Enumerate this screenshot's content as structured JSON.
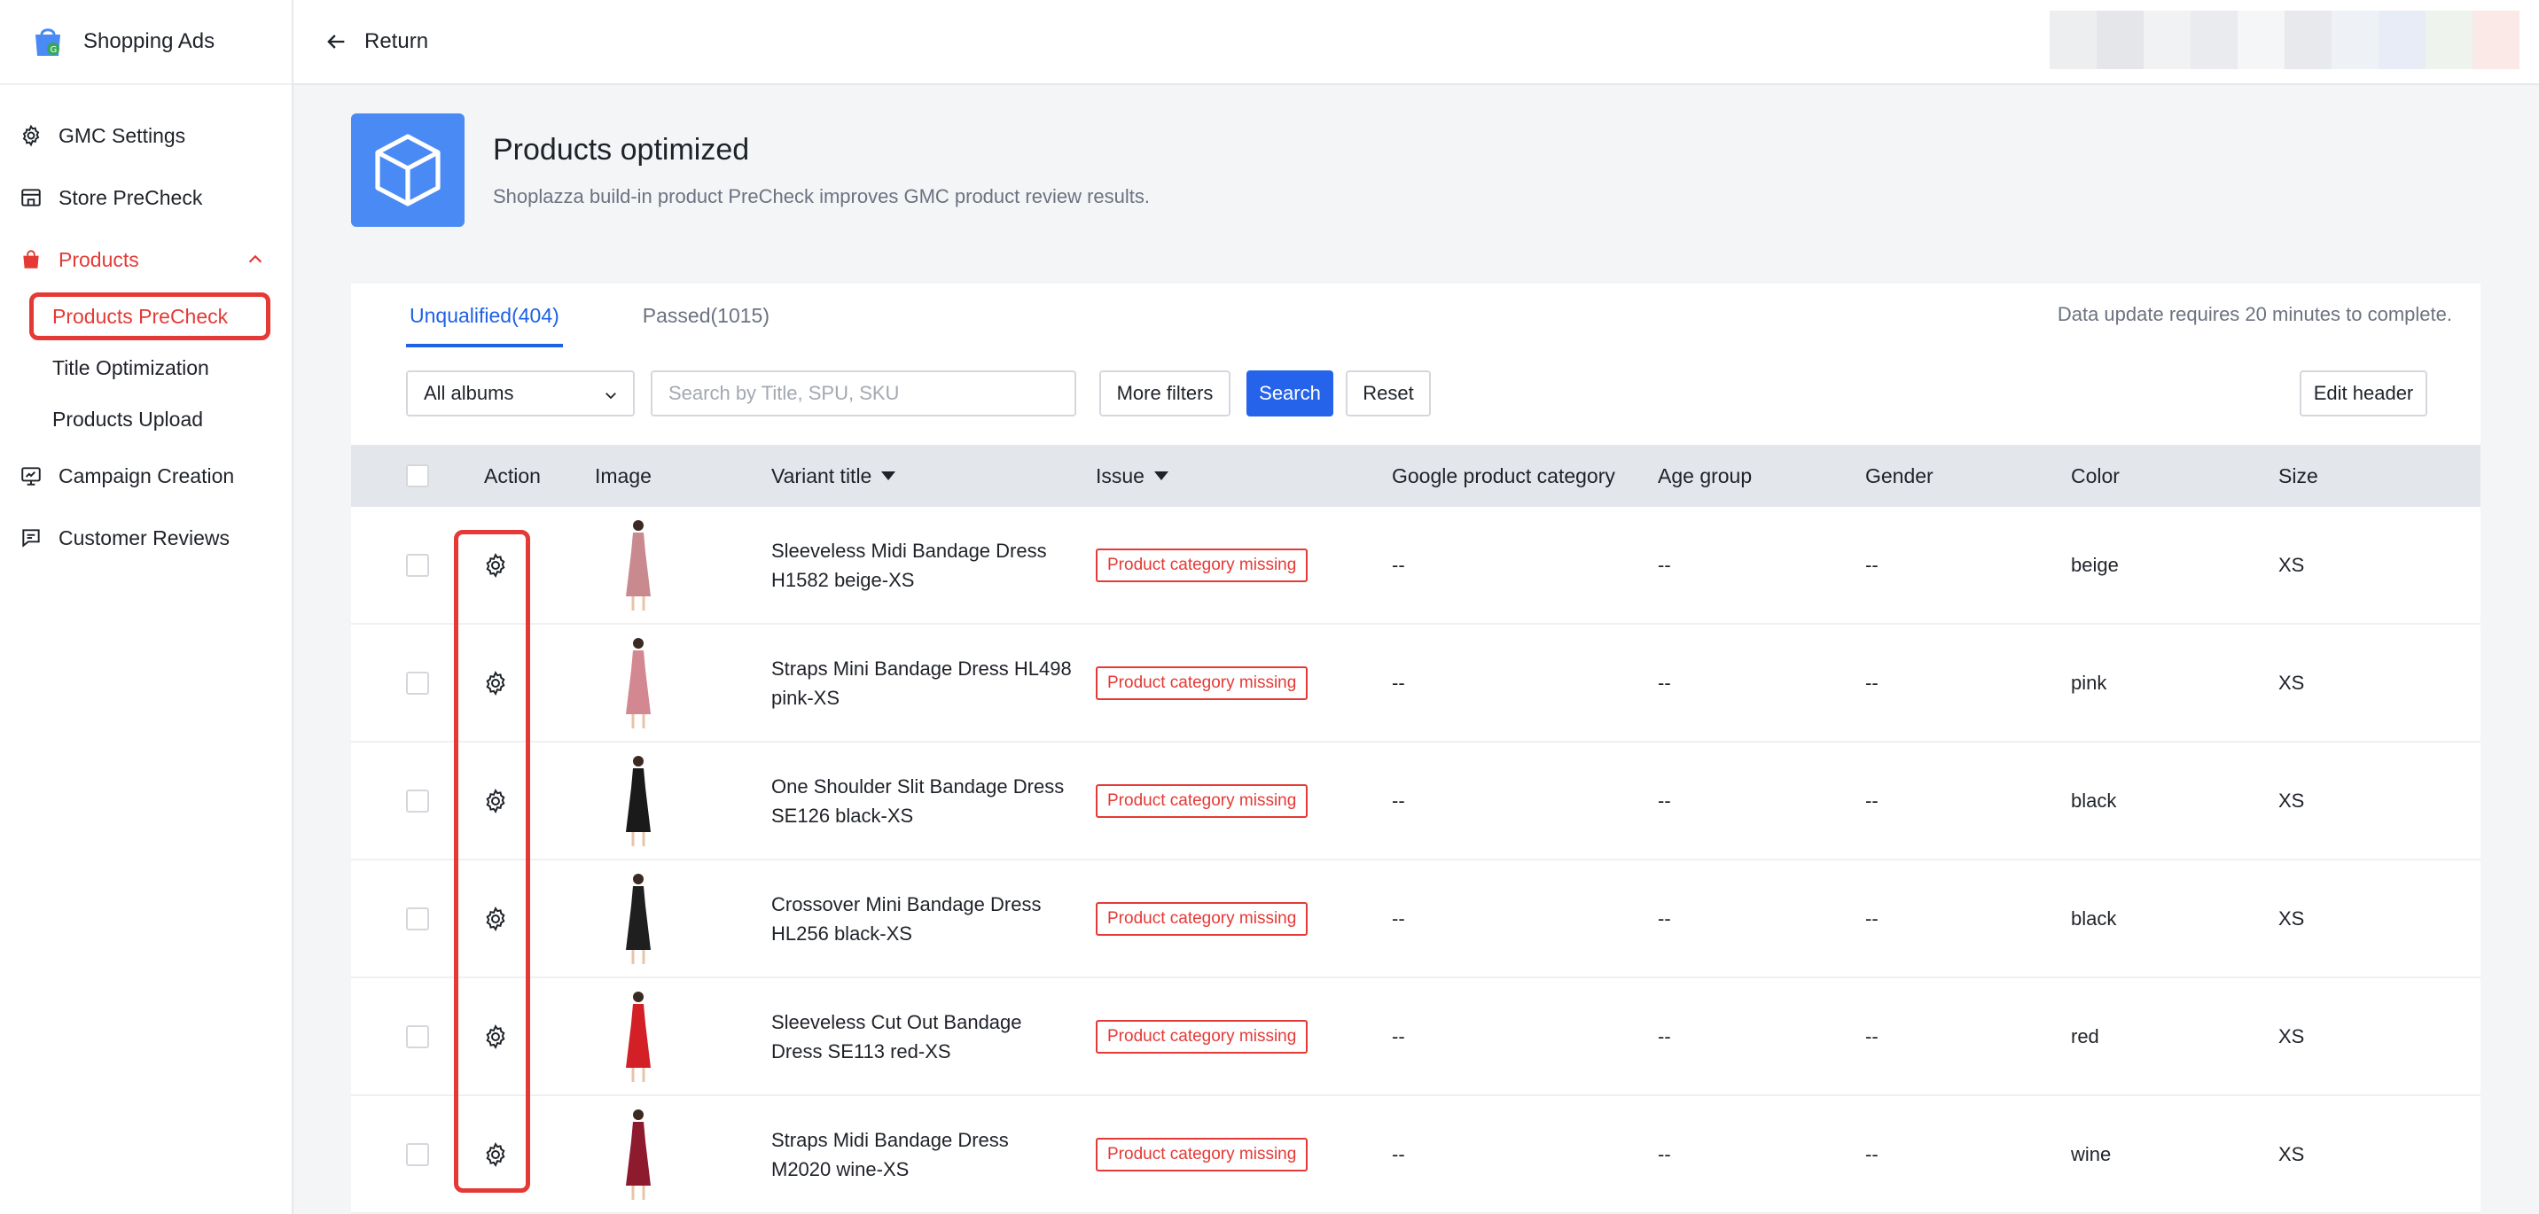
{
  "app": {
    "name": "Shopping Ads"
  },
  "sidebar": {
    "items": [
      {
        "label": "GMC Settings",
        "icon": "gear-icon"
      },
      {
        "label": "Store PreCheck",
        "icon": "store-icon"
      },
      {
        "label": "Products",
        "icon": "shopping-bag-icon",
        "expanded": true,
        "children": [
          {
            "label": "Products PreCheck",
            "active": true
          },
          {
            "label": "Title Optimization"
          },
          {
            "label": "Products Upload"
          }
        ]
      },
      {
        "label": "Campaign Creation",
        "icon": "campaign-icon"
      },
      {
        "label": "Customer Reviews",
        "icon": "reviews-icon"
      }
    ]
  },
  "topbar": {
    "return_label": "Return"
  },
  "header": {
    "title": "Products optimized",
    "subtitle": "Shoplazza build-in product PreCheck improves GMC product review results."
  },
  "tabs": [
    {
      "label": "Unqualified(404)",
      "active": true
    },
    {
      "label": "Passed(1015)",
      "active": false
    }
  ],
  "update_note": "Data update requires 20 minutes to complete.",
  "filters": {
    "album_select": "All albums",
    "search_placeholder": "Search by Title, SPU, SKU",
    "more_filters": "More filters",
    "search": "Search",
    "reset": "Reset",
    "edit_header": "Edit header"
  },
  "table": {
    "columns": [
      "Action",
      "Image",
      "Variant title",
      "Issue",
      "Google product category",
      "Age group",
      "Gender",
      "Color",
      "Size"
    ],
    "rows": [
      {
        "variant_title": "Sleeveless Midi Bandage Dress H1582 beige-XS",
        "issue": "Product category missing",
        "category": "--",
        "age_group": "--",
        "gender": "--",
        "color": "beige",
        "size": "XS",
        "dress_color": "#c98a8f"
      },
      {
        "variant_title": "Straps Mini Bandage Dress HL498 pink-XS",
        "issue": "Product category missing",
        "category": "--",
        "age_group": "--",
        "gender": "--",
        "color": "pink",
        "size": "XS",
        "dress_color": "#d38891"
      },
      {
        "variant_title": "One Shoulder Slit Bandage Dress SE126 black-XS",
        "issue": "Product category missing",
        "category": "--",
        "age_group": "--",
        "gender": "--",
        "color": "black",
        "size": "XS",
        "dress_color": "#1a1a1a"
      },
      {
        "variant_title": "Crossover Mini Bandage Dress HL256 black-XS",
        "issue": "Product category missing",
        "category": "--",
        "age_group": "--",
        "gender": "--",
        "color": "black",
        "size": "XS",
        "dress_color": "#1f1f1f"
      },
      {
        "variant_title": "Sleeveless Cut Out Bandage Dress SE113 red-XS",
        "issue": "Product category missing",
        "category": "--",
        "age_group": "--",
        "gender": "--",
        "color": "red",
        "size": "XS",
        "dress_color": "#d32027"
      },
      {
        "variant_title": "Straps Midi Bandage Dress M2020 wine-XS",
        "issue": "Product category missing",
        "category": "--",
        "age_group": "--",
        "gender": "--",
        "color": "wine",
        "size": "XS",
        "dress_color": "#8e1a2e"
      }
    ]
  },
  "colors": {
    "accent": "#2563eb",
    "danger": "#e53935",
    "brand": "#4a8af4"
  }
}
